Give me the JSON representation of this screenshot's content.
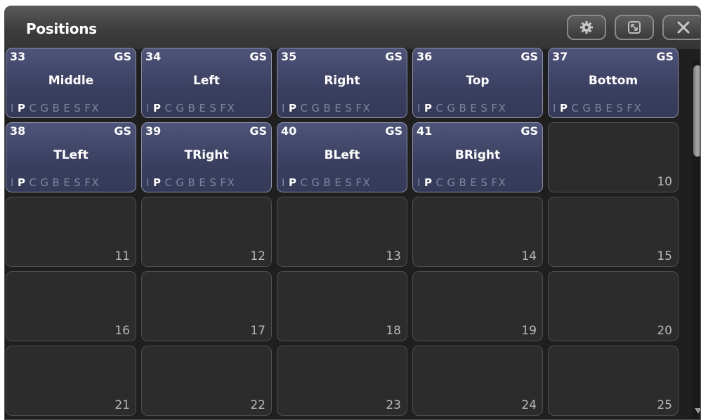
{
  "window": {
    "title": "Positions",
    "buttons": [
      {
        "name": "settings-button",
        "icon": "gear-icon"
      },
      {
        "name": "resize-button",
        "icon": "resize-icon"
      },
      {
        "name": "close-button",
        "icon": "close-icon"
      }
    ]
  },
  "attributes": [
    "I",
    "P",
    "C",
    "G",
    "B",
    "E",
    "S",
    "FX"
  ],
  "active_attribute": "P",
  "palettes": [
    {
      "number": "33",
      "gs": "GS",
      "label": "Middle"
    },
    {
      "number": "34",
      "gs": "GS",
      "label": "Left"
    },
    {
      "number": "35",
      "gs": "GS",
      "label": "Right"
    },
    {
      "number": "36",
      "gs": "GS",
      "label": "Top"
    },
    {
      "number": "37",
      "gs": "GS",
      "label": "Bottom"
    },
    {
      "number": "38",
      "gs": "GS",
      "label": "TLeft"
    },
    {
      "number": "39",
      "gs": "GS",
      "label": "TRight"
    },
    {
      "number": "40",
      "gs": "GS",
      "label": "BLeft"
    },
    {
      "number": "41",
      "gs": "GS",
      "label": "BRight"
    }
  ],
  "empty_slots": [
    "10",
    "11",
    "12",
    "13",
    "14",
    "15",
    "16",
    "17",
    "18",
    "19",
    "20",
    "21",
    "22",
    "23",
    "24",
    "25"
  ],
  "colors": {
    "palette_fill": "#3f4466",
    "palette_border": "#8c90a8",
    "empty_fill": "#2c2c2c",
    "window_bg": "#1f1f1f"
  }
}
